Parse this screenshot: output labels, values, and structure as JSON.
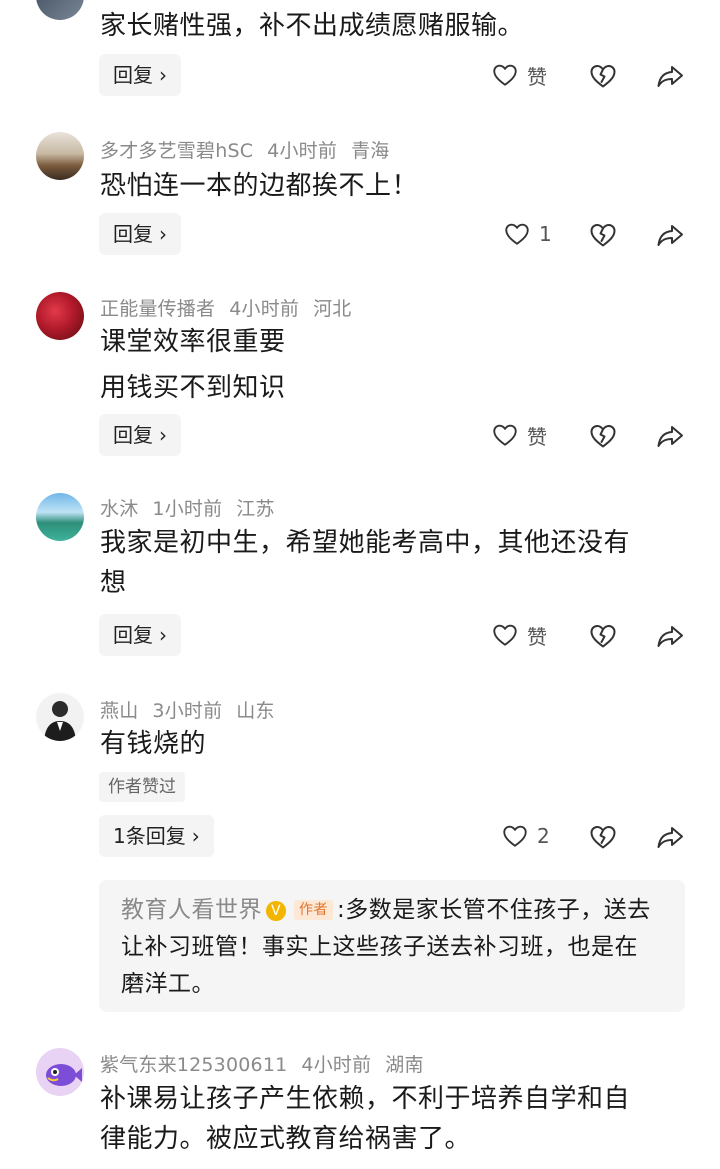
{
  "comments": [
    {
      "text": "家长赌性强，补不出成绩愿赌服输。",
      "reply": "回复",
      "like": "赞"
    },
    {
      "name": "多才多艺雪碧hSC",
      "time": "4小时前",
      "loc": "青海",
      "text": "恐怕连一本的边都挨不上！",
      "reply": "回复",
      "like": "1"
    },
    {
      "name": "正能量传播者",
      "time": "4小时前",
      "loc": "河北",
      "text1": "课堂效率很重要",
      "text2": "用钱买不到知识",
      "reply": "回复",
      "like": "赞"
    },
    {
      "name": "水沐",
      "time": "1小时前",
      "loc": "江苏",
      "text1": "我家是初中生，希望她能考高中，其他还没有",
      "text2": "想",
      "reply": "回复",
      "like": "赞"
    },
    {
      "name": "燕山",
      "time": "3小时前",
      "loc": "山东",
      "text": "有钱烧的",
      "author_liked": "作者赞过",
      "reply": "1条回复",
      "like": "2",
      "sub_reply": {
        "name": "教育人看世界",
        "tag": "作者",
        "separator": ":",
        "text": "多数是家长管不住孩子，送去让补习班管！事实上这些孩子送去补习班，也是在磨洋工。"
      }
    },
    {
      "name": "紫气东来125300611",
      "time": "4小时前",
      "loc": "湖南",
      "text1": "补课易让孩子产生依赖，不利于培养自学和自",
      "text2": "律能力。被应式教育给祸害了。"
    }
  ],
  "icons": {
    "chevron": "›",
    "heart": "heart-icon",
    "dislike": "broken-heart-icon",
    "share": "share-arrow-icon",
    "verified": "V"
  },
  "colors": {
    "meta_text": "#8a8a8a",
    "button_bg": "#f4f4f4",
    "author_tag": "#e0752c",
    "verified": "#f2b500"
  }
}
